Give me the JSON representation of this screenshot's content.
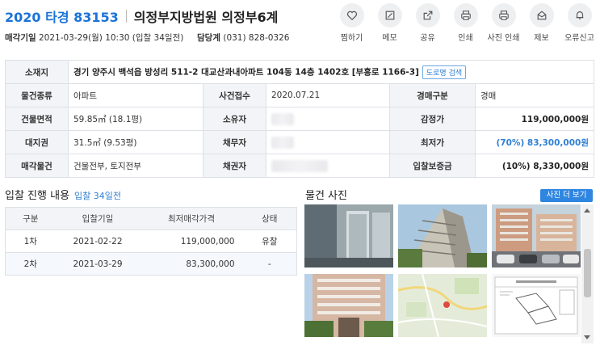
{
  "header": {
    "case_number": "2020 타경 83153",
    "court": "의정부지방법원 의정부6계",
    "sale_label": "매각기일",
    "sale_value": "2021-03-29(월) 10:30 (입찰 34일전)",
    "contact_label": "담당계",
    "contact_value": "(031) 828-0326"
  },
  "actions": [
    {
      "label": "찜하기",
      "icon": "heart-icon"
    },
    {
      "label": "메모",
      "icon": "memo-icon"
    },
    {
      "label": "공유",
      "icon": "share-icon"
    },
    {
      "label": "인쇄",
      "icon": "print-icon"
    },
    {
      "label": "사진 인쇄",
      "icon": "photo-print-icon"
    },
    {
      "label": "제보",
      "icon": "report-icon"
    },
    {
      "label": "오류신고",
      "icon": "bell-icon"
    }
  ],
  "info": {
    "location_label": "소재지",
    "address_bold": "경기 양주시 백석읍 방성리 511-2 대교산과내아파트 104동 14층 1402호 [부흥로 1166-3]",
    "road_btn": "도로명 검색",
    "type_label": "물건종류",
    "type_value": "아파트",
    "received_label": "사건접수",
    "received_value": "2020.07.21",
    "auction_type_label": "경매구분",
    "auction_type_value": "경매",
    "building_area_label": "건물면적",
    "building_area_value": "59.85㎡ (18.1평)",
    "owner_label": "소유자",
    "appraisal_label": "감정가",
    "appraisal_value": "119,000,000원",
    "land_label": "대지권",
    "land_value": "31.5㎡ (9.53평)",
    "debtor_label": "채무자",
    "minimum_label": "최저가",
    "minimum_value": "(70%) 83,300,000원",
    "sale_items_label": "매각물건",
    "sale_items_value": "건물전부, 토지전부",
    "creditor_label": "채권자",
    "deposit_label": "입찰보증금",
    "deposit_value": "(10%) 8,330,000원"
  },
  "bids": {
    "title": "입찰 진행 내용",
    "days": "입찰 34일전",
    "headers": [
      "구분",
      "입찰기일",
      "최저매각가격",
      "상태"
    ],
    "rows": [
      {
        "round": "1차",
        "date": "2021-02-22",
        "price": "119,000,000",
        "status": "유찰"
      },
      {
        "round": "2차",
        "date": "2021-03-29",
        "price": "83,300,000",
        "status": "-"
      }
    ]
  },
  "photos": {
    "title": "물건 사진",
    "more_btn": "사진 더 보기"
  }
}
